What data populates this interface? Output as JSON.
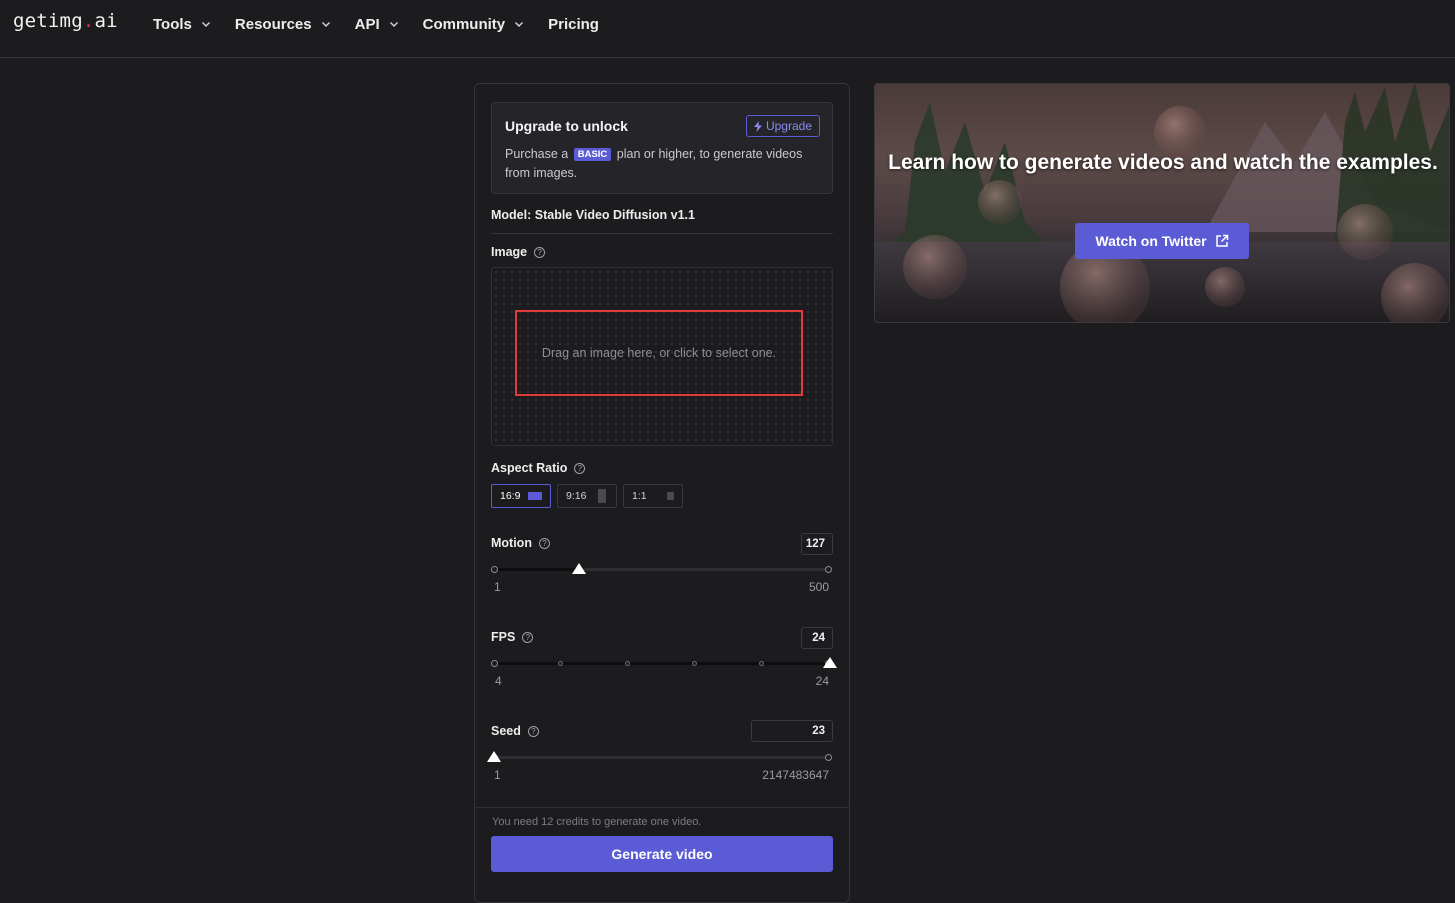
{
  "nav": {
    "logo_main": "getimg",
    "logo_dot": ".",
    "logo_tld": "ai",
    "items": [
      {
        "label": "Tools",
        "has_dropdown": true
      },
      {
        "label": "Resources",
        "has_dropdown": true
      },
      {
        "label": "API",
        "has_dropdown": true
      },
      {
        "label": "Community",
        "has_dropdown": true
      },
      {
        "label": "Pricing",
        "has_dropdown": false
      }
    ]
  },
  "upgrade": {
    "title": "Upgrade to unlock",
    "button_label": "Upgrade",
    "text_before": "Purchase a",
    "badge": "BASIC",
    "text_after": "plan or higher, to generate videos from images."
  },
  "model": {
    "label": "Model: Stable Video Diffusion v1.1"
  },
  "image": {
    "label": "Image",
    "dropzone_text": "Drag an image here, or click to select one."
  },
  "aspect_ratio": {
    "label": "Aspect Ratio",
    "options": [
      {
        "label": "16:9",
        "selected": true
      },
      {
        "label": "9:16",
        "selected": false
      },
      {
        "label": "1:1",
        "selected": false
      }
    ]
  },
  "motion": {
    "label": "Motion",
    "value": "127",
    "min": "1",
    "max": "500",
    "fraction": 0.2525
  },
  "fps": {
    "label": "FPS",
    "value": "24",
    "min": "4",
    "max": "24",
    "fraction": 1.0
  },
  "seed": {
    "label": "Seed",
    "value": "23",
    "min": "1",
    "max": "2147483647",
    "fraction": 0.0
  },
  "footer": {
    "credits_text": "You need 12 credits to generate one video.",
    "generate_label": "Generate video"
  },
  "banner": {
    "title": "Learn how to generate videos and watch the examples.",
    "button_label": "Watch on Twitter"
  },
  "colors": {
    "accent": "#5b5bd6",
    "background": "#1c1c1f",
    "highlight": "#e03a3a"
  }
}
